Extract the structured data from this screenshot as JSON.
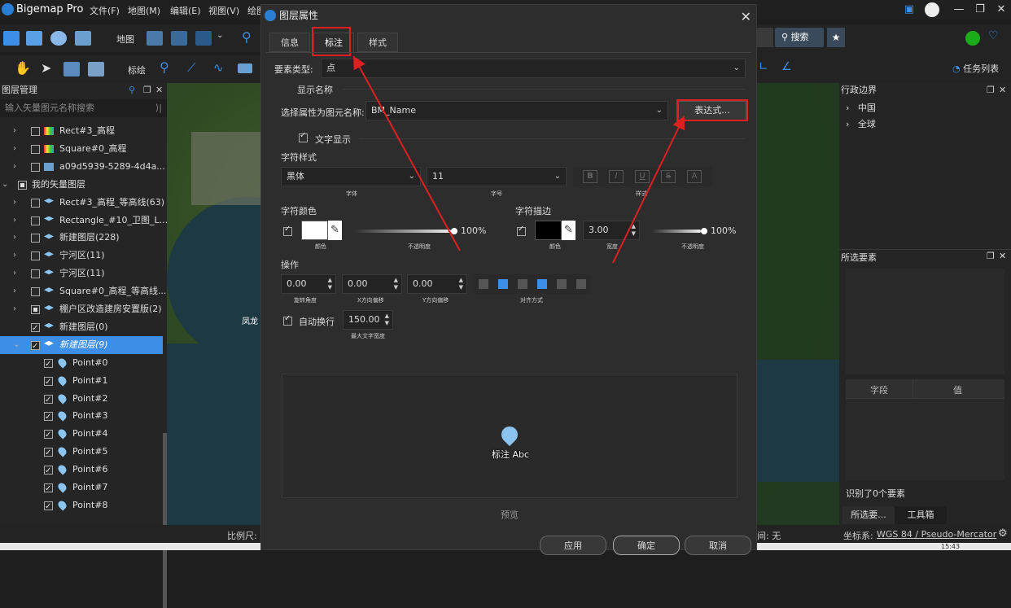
{
  "app": {
    "name": "Bigemap Pro"
  },
  "menu": [
    "文件(F)",
    "地图(M)",
    "编辑(E)",
    "视图(V)",
    "绘图"
  ],
  "toolbar": {
    "map_label": "地图",
    "draw_label": "标绘",
    "search_label": "搜索",
    "tasks_label": "任务列表"
  },
  "left_panel": {
    "title": "图层管理",
    "search_placeholder": "输入矢量图元名称搜索",
    "rows": [
      {
        "label": "Rect#3_高程"
      },
      {
        "label": "Square#0_高程"
      },
      {
        "label": "a09d5939-5289-4d4a..."
      },
      {
        "label": "我的矢量图层"
      },
      {
        "label": "Rect#3_高程_等高线(63)"
      },
      {
        "label": "Rectangle_#10_卫图_L..."
      },
      {
        "label": "新建图层(228)"
      },
      {
        "label": "宁河区(11)"
      },
      {
        "label": "宁河区(11)"
      },
      {
        "label": "Square#0_高程_等高线..."
      },
      {
        "label": "棚户区改造建房安置版(2)"
      },
      {
        "label": "新建图层(0)"
      },
      {
        "label": "新建图层(9)"
      },
      {
        "label": "Point#0"
      },
      {
        "label": "Point#1"
      },
      {
        "label": "Point#2"
      },
      {
        "label": "Point#3"
      },
      {
        "label": "Point#4"
      },
      {
        "label": "Point#5"
      },
      {
        "label": "Point#6"
      },
      {
        "label": "Point#7"
      },
      {
        "label": "Point#8"
      }
    ]
  },
  "map": {
    "place_label": "凤龙"
  },
  "right_panel": {
    "admin_title": "行政边界",
    "admin_items": [
      "中国",
      "全球"
    ],
    "selected_title": "所选要素",
    "col_field": "字段",
    "col_value": "值",
    "identified": "识别了0个要素",
    "tab1": "所选要...",
    "tab2": "工具箱"
  },
  "status": {
    "scale_label": "比例尺:",
    "time_label": "间: 无",
    "crs_label": "坐标系:",
    "crs_value": "WGS 84 / Pseudo-Mercator"
  },
  "dialog": {
    "title": "图层属性",
    "tabs": [
      "信息",
      "标注",
      "样式"
    ],
    "feature_type_label": "要素类型:",
    "feature_type_value": "点",
    "show_name_group": "显示名称",
    "attr_label": "选择属性为图元名称:",
    "attr_value": "BM_Name",
    "expr_button": "表达式...",
    "text_display": "文字显示",
    "font_style_label": "字符样式",
    "font_value": "黑体",
    "size_value": "11",
    "font_caption": "字体",
    "size_caption": "字号",
    "style_caption": "样式",
    "font_btns": [
      "B",
      "I",
      "U",
      "S",
      "A"
    ],
    "font_color_label": "字符颜色",
    "color_caption": "颜色",
    "opacity_caption": "不透明度",
    "font_opacity": "100%",
    "stroke_label": "字符描边",
    "stroke_width": "3.00",
    "width_caption": "宽度",
    "stroke_opacity": "100%",
    "ops_label": "操作",
    "rotate_value": "0.00",
    "rotate_caption": "旋转角度",
    "xoff_value": "0.00",
    "xoff_caption": "X方向偏移",
    "yoff_value": "0.00",
    "yoff_caption": "Y方向偏移",
    "align_caption": "对齐方式",
    "autowrap_label": "自动换行",
    "maxwidth_value": "150.00",
    "maxwidth_caption": "最大文字宽度",
    "preview_text": "标注 Abc",
    "preview_label": "预览",
    "btn_apply": "应用",
    "btn_ok": "确定",
    "btn_cancel": "取消"
  },
  "colors": {
    "accent": "#3c8ee6",
    "highlight": "#e02020",
    "font_color": "#ffffff",
    "stroke_color": "#000000"
  },
  "clock": "15:43"
}
